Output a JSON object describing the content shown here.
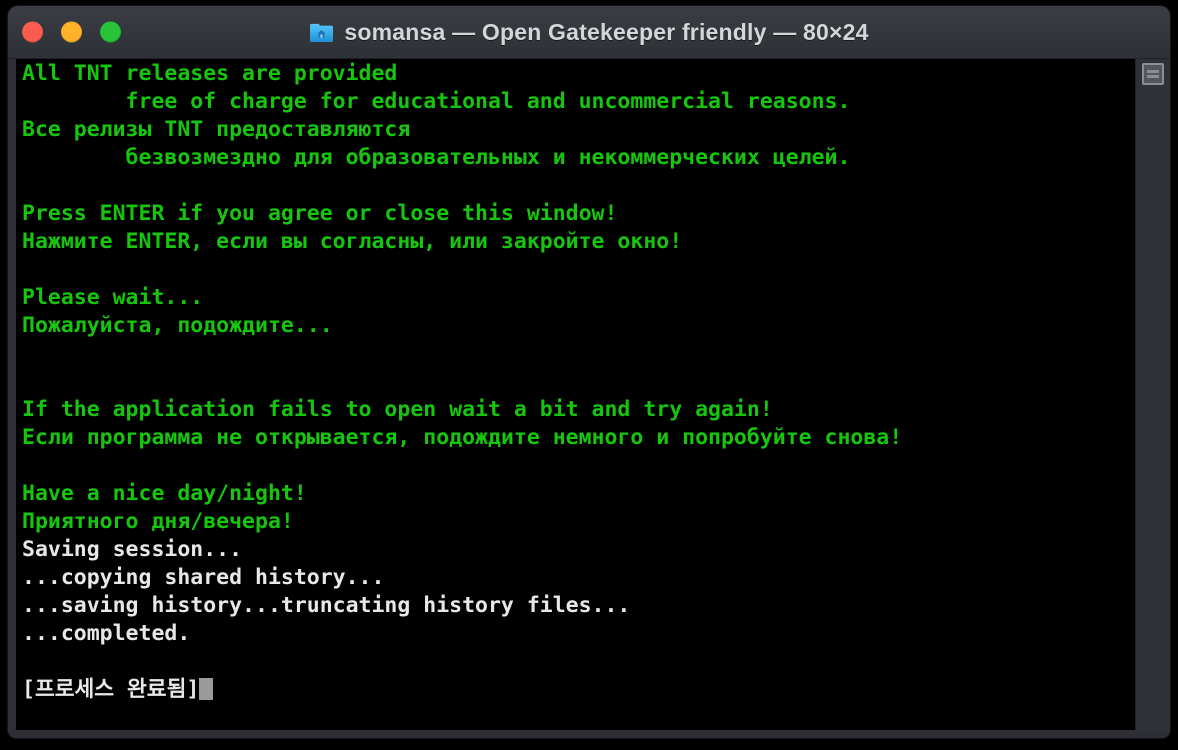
{
  "window": {
    "title": "somansa — Open Gatekeeper friendly — 80×24",
    "icon": "home-folder-icon",
    "controls": {
      "close_label": "",
      "minimize_label": "",
      "zoom_label": ""
    }
  },
  "colors": {
    "terminal_background": "#000000",
    "green_text": "#16c60c",
    "white_text": "#e8e8e8",
    "titlebar_background": "#33363b",
    "title_text": "#d4d6d9",
    "close_button": "#fc5b52",
    "minimize_button": "#feb32b",
    "zoom_button": "#27c43a",
    "cursor": "#9a9a9a"
  },
  "terminal": {
    "cols": 80,
    "rows": 24,
    "lines": [
      {
        "text": "All TNT releases are provided",
        "color": "green"
      },
      {
        "text": "        free of charge for educational and uncommercial reasons.",
        "color": "green"
      },
      {
        "text": "Все релизы TNT предоставляются",
        "color": "green"
      },
      {
        "text": "        безвозмездно для образовательных и некоммерческих целей.",
        "color": "green"
      },
      {
        "text": "",
        "color": "green"
      },
      {
        "text": "Press ENTER if you agree or close this window!",
        "color": "green"
      },
      {
        "text": "Нажмите ENTER, если вы согласны, или закройте окно!",
        "color": "green"
      },
      {
        "text": "",
        "color": "green"
      },
      {
        "text": "Please wait...",
        "color": "green"
      },
      {
        "text": "Пожалуйста, подождите...",
        "color": "green"
      },
      {
        "text": "",
        "color": "green"
      },
      {
        "text": "",
        "color": "green"
      },
      {
        "text": "If the application fails to open wait a bit and try again!",
        "color": "green"
      },
      {
        "text": "Если программа не открывается, подождите немного и попробуйте снова!",
        "color": "green"
      },
      {
        "text": "",
        "color": "green"
      },
      {
        "text": "Have a nice day/night!",
        "color": "green"
      },
      {
        "text": "Приятного дня/вечера!",
        "color": "green"
      },
      {
        "text": "Saving session...",
        "color": "white"
      },
      {
        "text": "...copying shared history...",
        "color": "white"
      },
      {
        "text": "...saving history...truncating history files...",
        "color": "white"
      },
      {
        "text": "...completed.",
        "color": "white"
      },
      {
        "text": "",
        "color": "white"
      },
      {
        "text": "[프로세스 완료됨]",
        "color": "white",
        "cursor": true
      }
    ]
  },
  "scrollbar": {
    "thumb_label": "scroll-marker"
  }
}
